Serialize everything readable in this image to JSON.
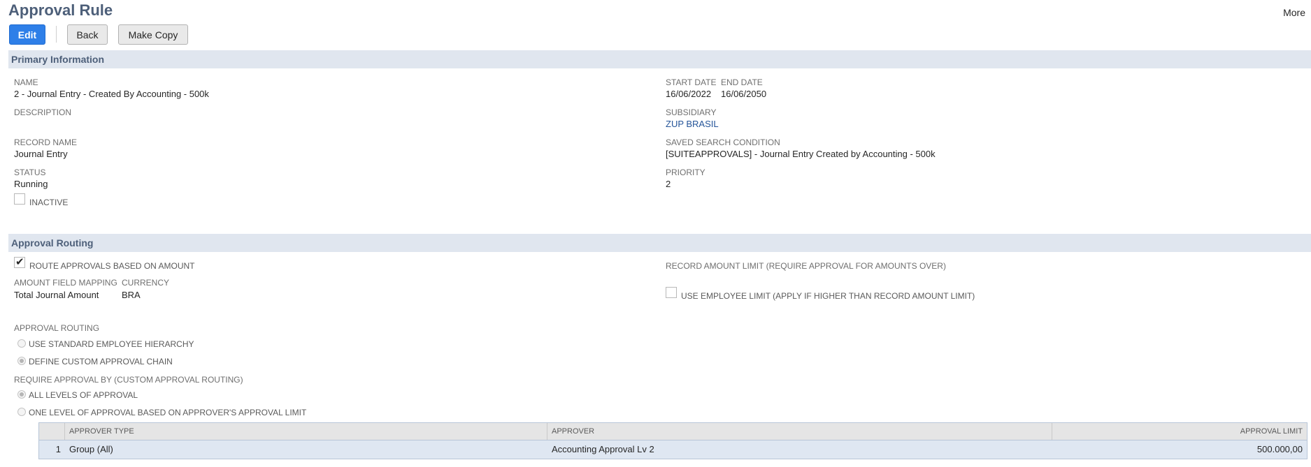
{
  "page": {
    "title": "Approval Rule",
    "more_label": "More"
  },
  "toolbar": {
    "edit_label": "Edit",
    "back_label": "Back",
    "copy_label": "Make Copy"
  },
  "primary": {
    "header": "Primary Information",
    "name_label": "NAME",
    "name_value": "2 - Journal Entry - Created By Accounting - 500k",
    "description_label": "DESCRIPTION",
    "record_name_label": "RECORD NAME",
    "record_name_value": "Journal Entry",
    "status_label": "STATUS",
    "status_value": "Running",
    "inactive_label": "INACTIVE",
    "inactive_checked": false,
    "start_date_label": "START DATE",
    "start_date_value": "16/06/2022",
    "end_date_label": "END DATE",
    "end_date_value": "16/06/2050",
    "subsidiary_label": "SUBSIDIARY",
    "subsidiary_value": "ZUP BRASIL",
    "saved_search_label": "SAVED SEARCH CONDITION",
    "saved_search_value": "[SUITEAPPROVALS] - Journal Entry Created by Accounting - 500k",
    "priority_label": "PRIORITY",
    "priority_value": "2"
  },
  "routing": {
    "header": "Approval Routing",
    "route_amount_label": "ROUTE APPROVALS BASED ON AMOUNT",
    "route_amount_checked": true,
    "amount_field_label": "AMOUNT FIELD MAPPING",
    "amount_field_value": "Total Journal Amount",
    "currency_label": "CURRENCY",
    "currency_value": "BRA",
    "record_limit_label": "RECORD AMOUNT LIMIT (REQUIRE APPROVAL FOR AMOUNTS OVER)",
    "employee_limit_label": "USE EMPLOYEE LIMIT (APPLY IF HIGHER THAN RECORD AMOUNT LIMIT)",
    "employee_limit_checked": false,
    "approval_routing_label": "APPROVAL ROUTING",
    "routing_options": [
      {
        "label": "USE STANDARD EMPLOYEE HIERARCHY",
        "selected": false
      },
      {
        "label": "DEFINE CUSTOM APPROVAL CHAIN",
        "selected": true
      }
    ],
    "require_label": "REQUIRE APPROVAL BY (CUSTOM APPROVAL ROUTING)",
    "require_options": [
      {
        "label": "ALL LEVELS OF APPROVAL",
        "selected": true
      },
      {
        "label": "ONE LEVEL OF APPROVAL BASED ON APPROVER'S APPROVAL LIMIT",
        "selected": false
      }
    ]
  },
  "approvers_table": {
    "columns": [
      "",
      "APPROVER TYPE",
      "APPROVER",
      "APPROVAL LIMIT"
    ],
    "rows": [
      {
        "num": "1",
        "type": "Group (All)",
        "approver": "Accounting Approval Lv 2",
        "limit": "500.000,00"
      }
    ]
  }
}
